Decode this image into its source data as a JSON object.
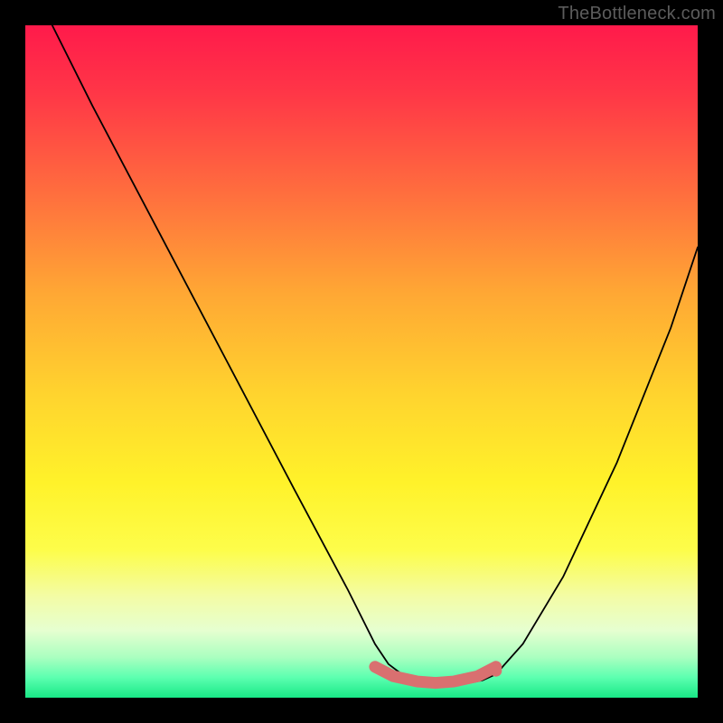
{
  "watermark": "TheBottleneck.com",
  "chart_data": {
    "type": "line",
    "title": "",
    "xlabel": "",
    "ylabel": "",
    "xlim": [
      0,
      100
    ],
    "ylim": [
      0,
      100
    ],
    "series": [
      {
        "name": "curve",
        "x": [
          4,
          10,
          20,
          30,
          40,
          48,
          52,
          54,
          56,
          58,
          60,
          62,
          64,
          66,
          68,
          70,
          74,
          80,
          88,
          96,
          100
        ],
        "y": [
          100,
          88,
          69,
          50,
          31,
          16,
          8,
          5,
          3.5,
          2.6,
          2.2,
          2.0,
          2.0,
          2.2,
          2.6,
          3.5,
          8,
          18,
          35,
          55,
          67
        ]
      }
    ],
    "flat_region": {
      "x_start": 52,
      "x_end": 70,
      "y": 2.6,
      "color": "#d97070"
    },
    "flat_endpoint": {
      "x": 70,
      "y": 4,
      "color": "#d97070"
    },
    "background": {
      "type": "vertical-gradient",
      "stops": [
        {
          "pos": 0.0,
          "color": "#ff1a4b"
        },
        {
          "pos": 0.55,
          "color": "#ffd42e"
        },
        {
          "pos": 0.8,
          "color": "#fdfd4a"
        },
        {
          "pos": 1.0,
          "color": "#18e886"
        }
      ]
    }
  }
}
